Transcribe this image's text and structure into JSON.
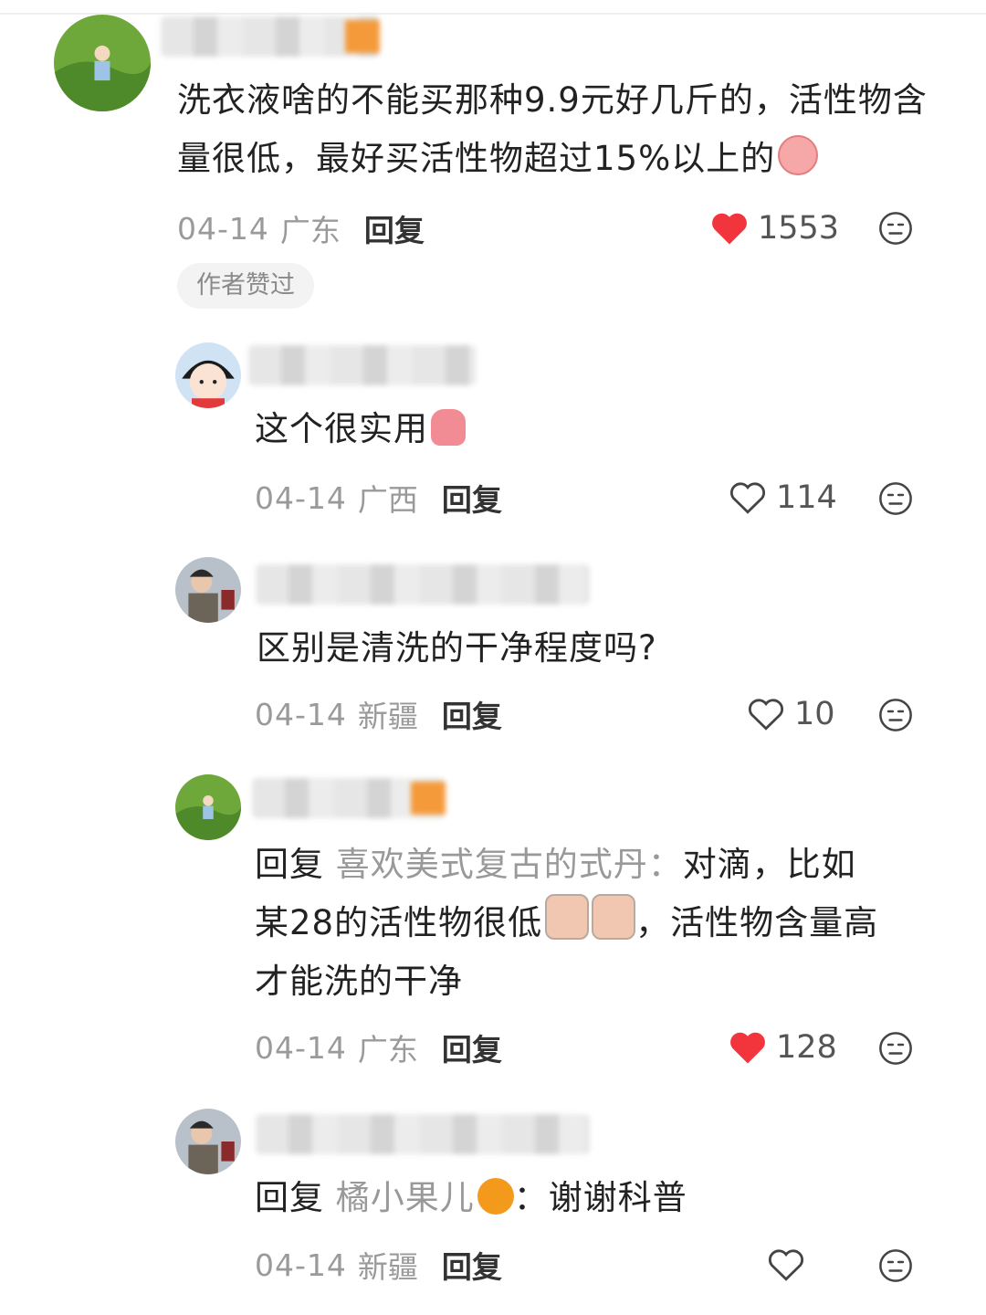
{
  "comments": [
    {
      "text": "洗衣液啥的不能买那种9.9元好几斤的，活性物含量很低，最好买活性物超过15%以上的",
      "date": "04-14",
      "location": "广东",
      "reply_label": "回复",
      "likes": "1553",
      "liked": true,
      "badge": "作者赞过"
    },
    {
      "text": "这个很实用",
      "date": "04-14",
      "location": "广西",
      "reply_label": "回复",
      "likes": "114",
      "liked": false
    },
    {
      "text": "区别是清洗的干净程度吗?",
      "date": "04-14",
      "location": "新疆",
      "reply_label": "回复",
      "likes": "10",
      "liked": false
    },
    {
      "reply_prefix": "回复",
      "reply_target": "喜欢美式复古的式丹：",
      "text_a": "对滴，比如",
      "text_b": "某28的活性物很低",
      "text_c": "，活性物含量高",
      "text_d": "才能洗的干净",
      "date": "04-14",
      "location": "广东",
      "reply_label": "回复",
      "likes": "128",
      "liked": true
    },
    {
      "reply_prefix": "回复",
      "reply_target": "橘小果儿",
      "reply_target_suffix": "：",
      "text": "谢谢科普",
      "date": "04-14",
      "location": "新疆",
      "reply_label": "回复",
      "likes": "",
      "liked": false
    }
  ],
  "colors": {
    "liked_heart": "#f2343c",
    "muted": "#9a9a9a",
    "orange_mark": "#f59a3a"
  },
  "icons": {
    "like": "heart-icon",
    "dislike": "neutral-face-icon"
  }
}
